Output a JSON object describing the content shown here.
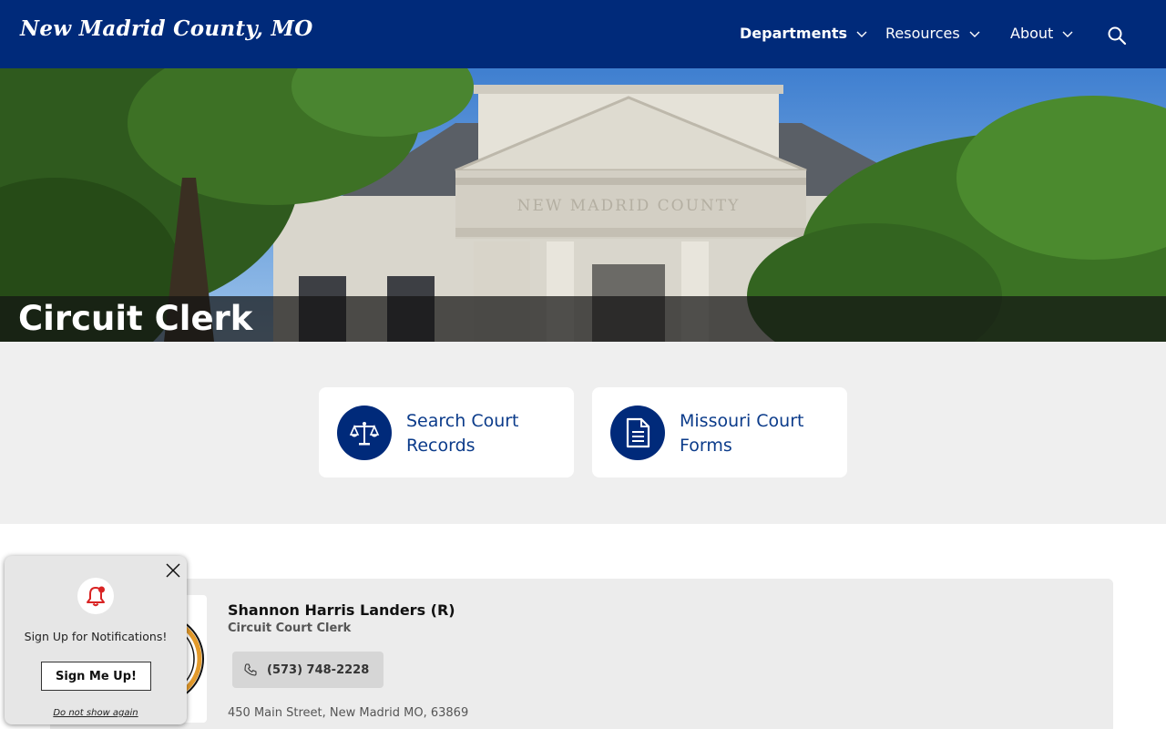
{
  "header": {
    "logo_text": "New Madrid County, MO",
    "nav": [
      {
        "label": "Departments"
      },
      {
        "label": "Resources"
      },
      {
        "label": "About"
      }
    ]
  },
  "hero": {
    "title": "Circuit Clerk",
    "building_inscription": "NEW MADRID COUNTY"
  },
  "quick_links": [
    {
      "label": "Search Court Records",
      "icon": "scales-icon"
    },
    {
      "label": "Missouri Court Forms",
      "icon": "document-icon"
    }
  ],
  "official": {
    "name": "Shannon Harris Landers (R)",
    "title": "Circuit Court Clerk",
    "phone": "(573) 748-2228",
    "address": "450 Main Street, New Madrid MO, 63869"
  },
  "notification_popup": {
    "message": "Sign Up for Notifications!",
    "button_label": "Sign Me Up!",
    "dismiss_label": "Do not show again"
  },
  "colors": {
    "brand_navy": "#002a7a",
    "link_blue": "#0b3b8a",
    "quick_bg": "#efefef",
    "bell_red": "#d92323"
  }
}
